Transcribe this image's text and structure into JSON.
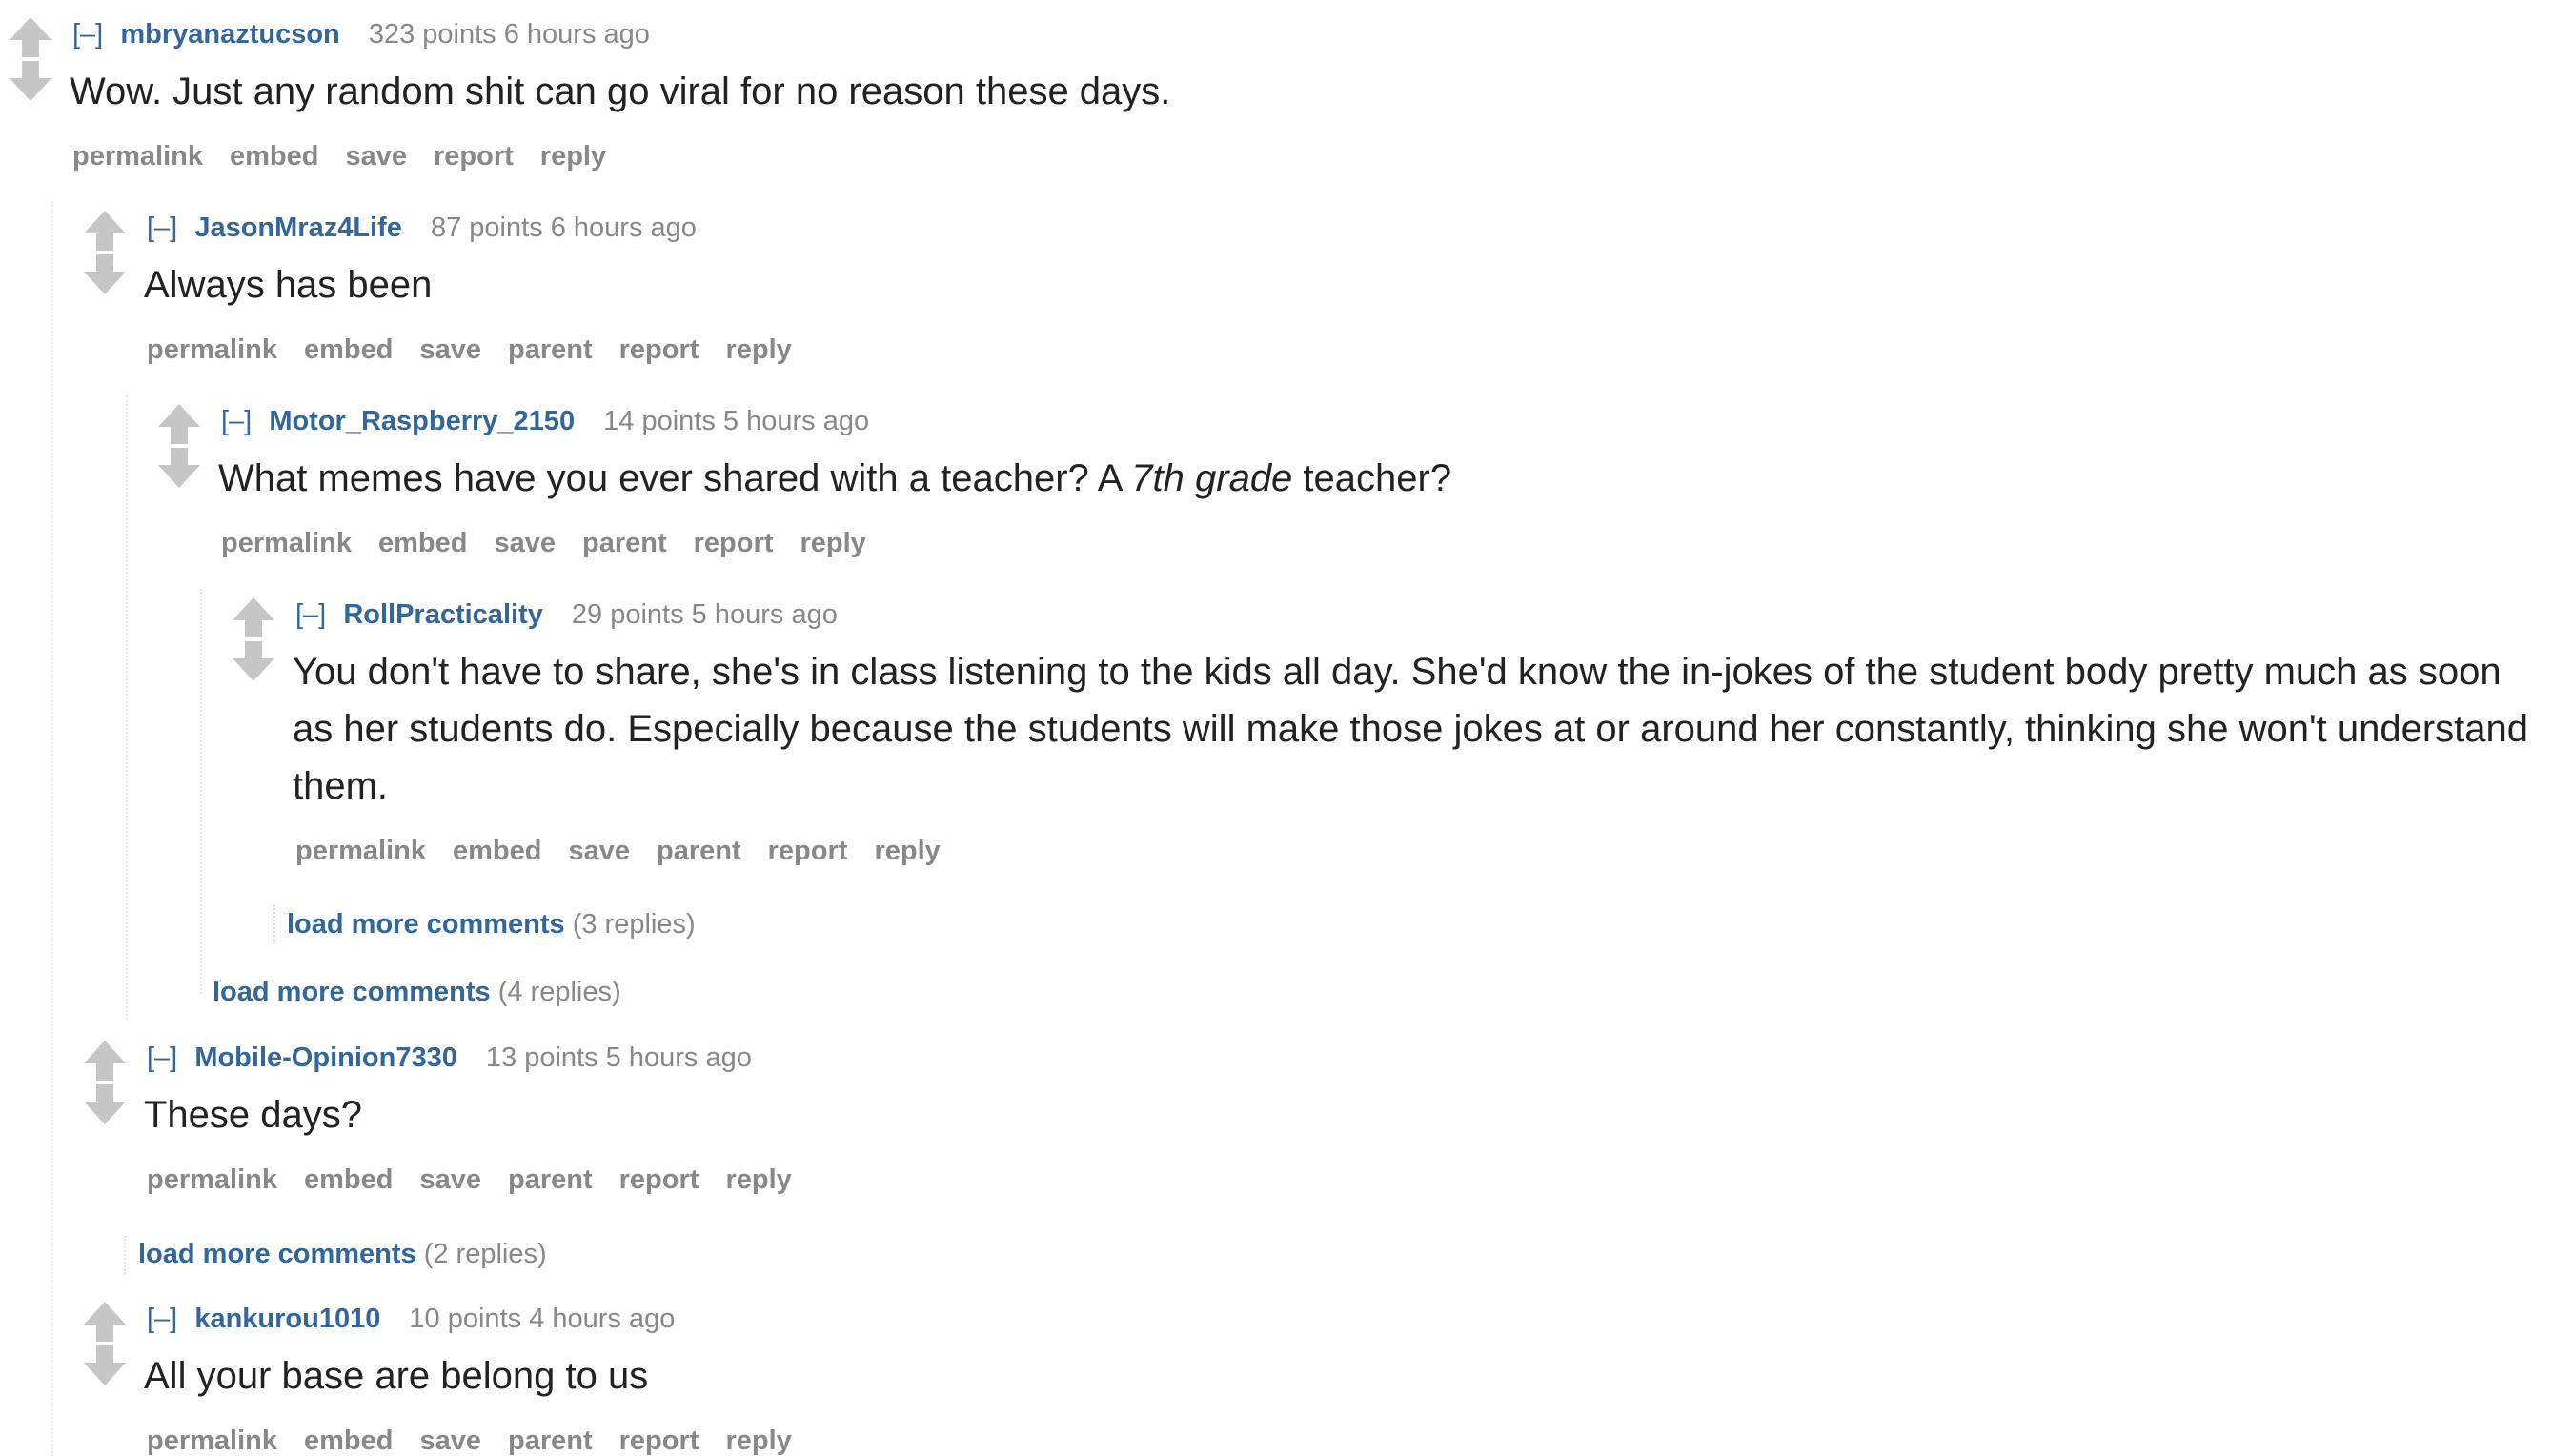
{
  "comments": [
    {
      "toggle": "[–]",
      "author": "mbryanaztucson",
      "score": "323 points",
      "time": "6 hours ago",
      "body": "Wow. Just any random shit can go viral for no reason these days.",
      "buttons": [
        "permalink",
        "embed",
        "save",
        "report",
        "reply"
      ]
    },
    {
      "toggle": "[–]",
      "author": "JasonMraz4Life",
      "score": "87 points",
      "time": "6 hours ago",
      "body": "Always has been",
      "buttons": [
        "permalink",
        "embed",
        "save",
        "parent",
        "report",
        "reply"
      ]
    },
    {
      "toggle": "[–]",
      "author": "Motor_Raspberry_2150",
      "score": "14 points",
      "time": "5 hours ago",
      "body_before": "What memes have you ever shared with a teacher? A ",
      "body_em": "7th grade",
      "body_after": " teacher?",
      "buttons": [
        "permalink",
        "embed",
        "save",
        "parent",
        "report",
        "reply"
      ]
    },
    {
      "toggle": "[–]",
      "author": "RollPracticality",
      "score": "29 points",
      "time": "5 hours ago",
      "body": "You don't have to share, she's in class listening to the kids all day. She'd know the in-jokes of the student body pretty much as soon as her students do. Especially because the students will make those jokes at or around her constantly, thinking she won't understand them.",
      "buttons": [
        "permalink",
        "embed",
        "save",
        "parent",
        "report",
        "reply"
      ]
    },
    {
      "toggle": "[–]",
      "author": "Mobile-Opinion7330",
      "score": "13 points",
      "time": "5 hours ago",
      "body": "These days?",
      "buttons": [
        "permalink",
        "embed",
        "save",
        "parent",
        "report",
        "reply"
      ]
    },
    {
      "toggle": "[–]",
      "author": "kankurou1010",
      "score": "10 points",
      "time": "4 hours ago",
      "body": "All your base are belong to us",
      "buttons": [
        "permalink",
        "embed",
        "save",
        "parent",
        "report",
        "reply"
      ]
    }
  ],
  "load_more": [
    {
      "label": "load more comments",
      "count": "(3 replies)"
    },
    {
      "label": "load more comments",
      "count": "(4 replies)"
    },
    {
      "label": "load more comments",
      "count": "(2 replies)"
    }
  ],
  "colors": {
    "link": "#336699",
    "meta": "#888888",
    "text": "#222222",
    "arrow": "#c6c6c6"
  },
  "icons": {
    "upvote": "upvote-arrow-icon",
    "downvote": "downvote-arrow-icon"
  }
}
